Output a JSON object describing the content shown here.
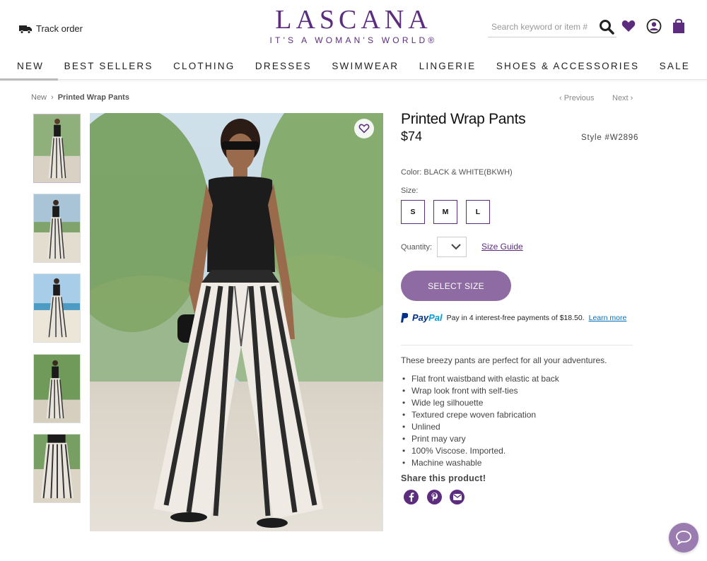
{
  "header": {
    "track_order": "Track order",
    "logo": "LASCANA",
    "tagline": "IT'S A WOMAN'S WORLD®",
    "search_placeholder": "Search keyword or item #",
    "brand_color": "#5c2d7e"
  },
  "nav": {
    "items": [
      {
        "label": "NEW",
        "active": true
      },
      {
        "label": "BEST SELLERS"
      },
      {
        "label": "CLOTHING"
      },
      {
        "label": "DRESSES"
      },
      {
        "label": "SWIMWEAR"
      },
      {
        "label": "LINGERIE"
      },
      {
        "label": "SHOES & ACCESSORIES"
      },
      {
        "label": "SALE"
      }
    ]
  },
  "breadcrumb": {
    "parent": "New",
    "separator": "›",
    "current": "Printed Wrap Pants"
  },
  "pager": {
    "previous": "‹ Previous",
    "next": "Next ›"
  },
  "product": {
    "title": "Printed Wrap Pants",
    "price": "$74",
    "style": "Style #W2896",
    "color": "Color: BLACK & WHITE(BKWH)",
    "size_label": "Size:",
    "sizes": [
      "S",
      "M",
      "L"
    ],
    "quantity_label": "Quantity:",
    "size_guide": "Size Guide",
    "cta": "SELECT SIZE",
    "cta_color": "#8f6ba3",
    "paypal_brand_1": "Pay",
    "paypal_brand_2": "Pal",
    "paypal_text": "Pay in 4 interest-free payments of $18.50.",
    "paypal_link": "Learn more",
    "description": "These breezy pants are perfect for all your adventures.",
    "features": [
      "Flat front waistband with elastic at back",
      "Wrap look front with self-ties",
      "Wide leg silhouette",
      "Textured crepe woven fabrication",
      "Unlined",
      "Print may vary",
      "100% Viscose. Imported.",
      "Machine washable"
    ],
    "share_label": "Share this product!",
    "share_icons": [
      "facebook-icon",
      "pinterest-icon",
      "email-icon"
    ]
  }
}
